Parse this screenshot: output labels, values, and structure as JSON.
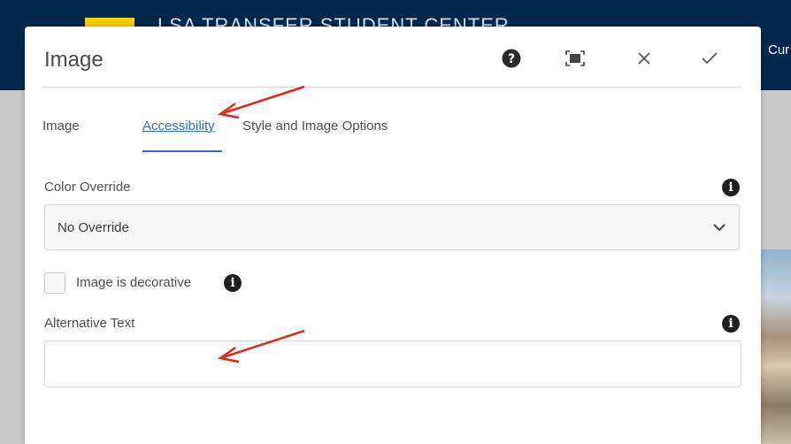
{
  "background": {
    "site_title": "LSA TRANSFER STUDENT CENTER",
    "nav_fragment": "Cur"
  },
  "dialog": {
    "title": "Image",
    "toolbar": {
      "help_icon": "question-circle-icon",
      "fullscreen_icon": "fullscreen-icon",
      "close_icon": "close-icon",
      "confirm_icon": "checkmark-icon"
    },
    "tabs": [
      {
        "label": "Image",
        "active": false
      },
      {
        "label": "Accessibility",
        "active": true
      },
      {
        "label": "Style and Image Options",
        "active": false
      }
    ],
    "color_override": {
      "label": "Color Override",
      "value": "No Override"
    },
    "decorative": {
      "label": "Image is decorative",
      "checked": false
    },
    "alt_text": {
      "label": "Alternative Text",
      "value": ""
    },
    "info_glyph": "i"
  },
  "colors": {
    "accent": "#326ec8",
    "annotation": "#e8231e",
    "header_bg": "#00274c"
  }
}
